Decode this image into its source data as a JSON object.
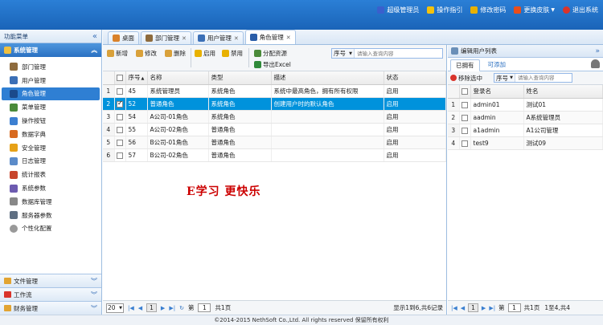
{
  "header": {
    "links": [
      {
        "label": "超级管理员",
        "icon": "user-icon",
        "color": "#3a5fcd"
      },
      {
        "label": "操作指引",
        "icon": "lightbulb-icon",
        "color": "#f4c20d"
      },
      {
        "label": "修改密码",
        "icon": "key-icon",
        "color": "#e8b100"
      },
      {
        "label": "更换皮肤",
        "icon": "palette-icon",
        "color": "#e94e1b"
      },
      {
        "label": "退出系统",
        "icon": "power-icon",
        "color": "#d9342b"
      }
    ]
  },
  "sidebar": {
    "title": "功能菜单",
    "collapse": "«",
    "group": {
      "label": "系统管理",
      "chevron": "︽"
    },
    "items": [
      {
        "label": "部门管理",
        "icon": "department-icon",
        "color": "#8e6b3d"
      },
      {
        "label": "用户管理",
        "icon": "user-icon",
        "color": "#3b6fb6"
      },
      {
        "label": "角色管理",
        "icon": "role-icon",
        "color": "#2a5da8"
      },
      {
        "label": "菜单管理",
        "icon": "menu-tree-icon",
        "color": "#4a8a3a"
      },
      {
        "label": "操作按钮",
        "icon": "cube-icon",
        "color": "#3c7fd1"
      },
      {
        "label": "数据字典",
        "icon": "dictionary-icon",
        "color": "#d86a1f"
      },
      {
        "label": "安全管理",
        "icon": "shield-icon",
        "color": "#e6a117"
      },
      {
        "label": "日志管理",
        "icon": "log-icon",
        "color": "#5b8bc9"
      },
      {
        "label": "统计报表",
        "icon": "chart-icon",
        "color": "#c8452c"
      },
      {
        "label": "系统参数",
        "icon": "params-icon",
        "color": "#6d5bb0"
      },
      {
        "label": "数据库管理",
        "icon": "database-icon",
        "color": "#888888"
      },
      {
        "label": "服务器参数",
        "icon": "server-icon",
        "color": "#5f6f82"
      },
      {
        "label": "个性化配置",
        "icon": "gear-icon",
        "color": "#999999"
      }
    ],
    "accordion": [
      {
        "label": "文件管理",
        "icon": "folder-icon",
        "color": "#e2a432"
      },
      {
        "label": "工作流",
        "icon": "workflow-icon",
        "color": "#d9342b"
      },
      {
        "label": "财务管理",
        "icon": "finance-icon",
        "color": "#e2a432"
      }
    ]
  },
  "tabs": [
    {
      "label": "桌面",
      "icon": "home-icon",
      "color": "#d9822b",
      "closable": false
    },
    {
      "label": "部门管理",
      "icon": "department-icon",
      "color": "#8e6b3d",
      "closable": true
    },
    {
      "label": "用户管理",
      "icon": "user-icon",
      "color": "#3b6fb6",
      "closable": true
    },
    {
      "label": "角色管理",
      "icon": "role-icon",
      "color": "#2a5da8",
      "closable": true
    }
  ],
  "toolbar": {
    "add": "新增",
    "edit": "修改",
    "delete": "删除",
    "enable": "启用",
    "disable": "禁用",
    "assign": "分配资源",
    "export": "导出Excel",
    "search_field": "序号",
    "search_placeholder": "请输入查询内容"
  },
  "grid": {
    "columns": [
      "序号",
      "名称",
      "类型",
      "描述",
      "状态"
    ],
    "rows": [
      {
        "rn": "1",
        "no": "45",
        "name": "系统管理员",
        "type": "系统角色",
        "desc": "系统中最高角色，拥有所有权限",
        "status": "启用",
        "checked": false
      },
      {
        "rn": "2",
        "no": "52",
        "name": "普通角色",
        "type": "系统角色",
        "desc": "创建用户时的默认角色",
        "status": "启用",
        "checked": true
      },
      {
        "rn": "3",
        "no": "54",
        "name": "A公司-01角色",
        "type": "系统角色",
        "desc": "",
        "status": "启用",
        "checked": false
      },
      {
        "rn": "4",
        "no": "55",
        "name": "A公司-02角色",
        "type": "普通角色",
        "desc": "",
        "status": "启用",
        "checked": false
      },
      {
        "rn": "5",
        "no": "56",
        "name": "B公司-01角色",
        "type": "普通角色",
        "desc": "",
        "status": "启用",
        "checked": false
      },
      {
        "rn": "6",
        "no": "57",
        "name": "B公司-02角色",
        "type": "普通角色",
        "desc": "",
        "status": "启用",
        "checked": false
      }
    ]
  },
  "watermark": "E学习  更快乐",
  "pager": {
    "page_size": "20",
    "current_page": "1",
    "page_label": "第",
    "total_pages": "共1页",
    "info": "显示1到6,共6记录"
  },
  "right_panel": {
    "title": "编辑用户列表",
    "collapse": "»",
    "tabs": [
      "已拥有",
      "可添加"
    ],
    "remove": "移除选中",
    "search_field": "序号",
    "search_placeholder": "请输入查询内容",
    "columns": [
      "登录名",
      "姓名"
    ],
    "rows": [
      {
        "rn": "1",
        "login": "admin01",
        "name": "测试01"
      },
      {
        "rn": "2",
        "login": "aadmin",
        "name": "A系统管理员"
      },
      {
        "rn": "3",
        "login": "a1admin",
        "name": "A1公司管理"
      },
      {
        "rn": "4",
        "login": "test9",
        "name": "测试09"
      }
    ],
    "pager": {
      "current_page": "1",
      "page_label": "第",
      "total_pages": "共1页",
      "info": "1至4,共4"
    }
  },
  "footer": "©2014-2015 NethSoft Co.,Ltd. All rights reserved 保留所有权利"
}
